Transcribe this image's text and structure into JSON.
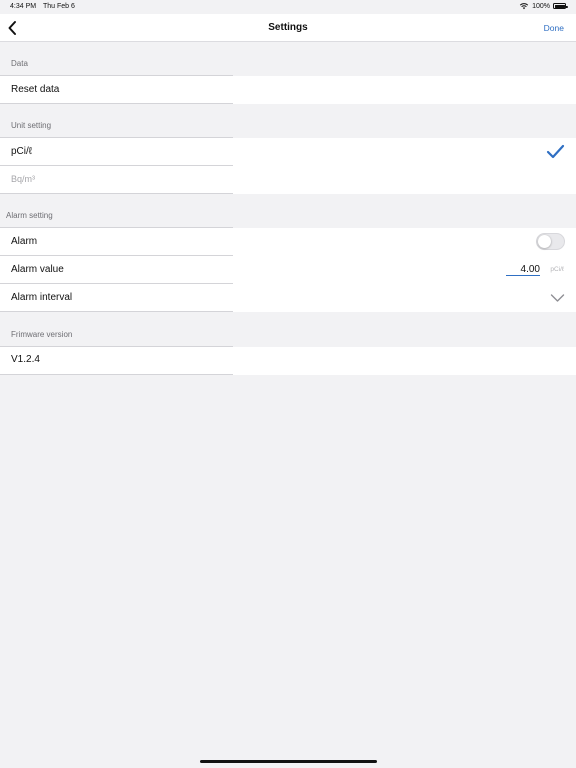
{
  "status_bar": {
    "time": "4:34 PM",
    "date": "Thu Feb 6",
    "battery": "100%"
  },
  "nav": {
    "title": "Settings",
    "done_label": "Done"
  },
  "sections": {
    "data": {
      "header": "Data",
      "reset_label": "Reset data"
    },
    "unit": {
      "header": "Unit setting",
      "options": [
        "pCi/ℓ",
        "Bq/m³"
      ],
      "selected": "pCi/ℓ"
    },
    "alarm": {
      "header": "Alarm setting",
      "alarm_label": "Alarm",
      "alarm_enabled": false,
      "value_label": "Alarm value",
      "value": "4.00",
      "value_unit": "pCi/ℓ",
      "interval_label": "Alarm interval"
    },
    "firmware": {
      "header": "Frimware version",
      "version": "V1.2.4"
    }
  },
  "colors": {
    "accent": "#2f6fc3",
    "background": "#f2f2f4",
    "row": "#ffffff",
    "muted_text": "#6e6e73"
  }
}
